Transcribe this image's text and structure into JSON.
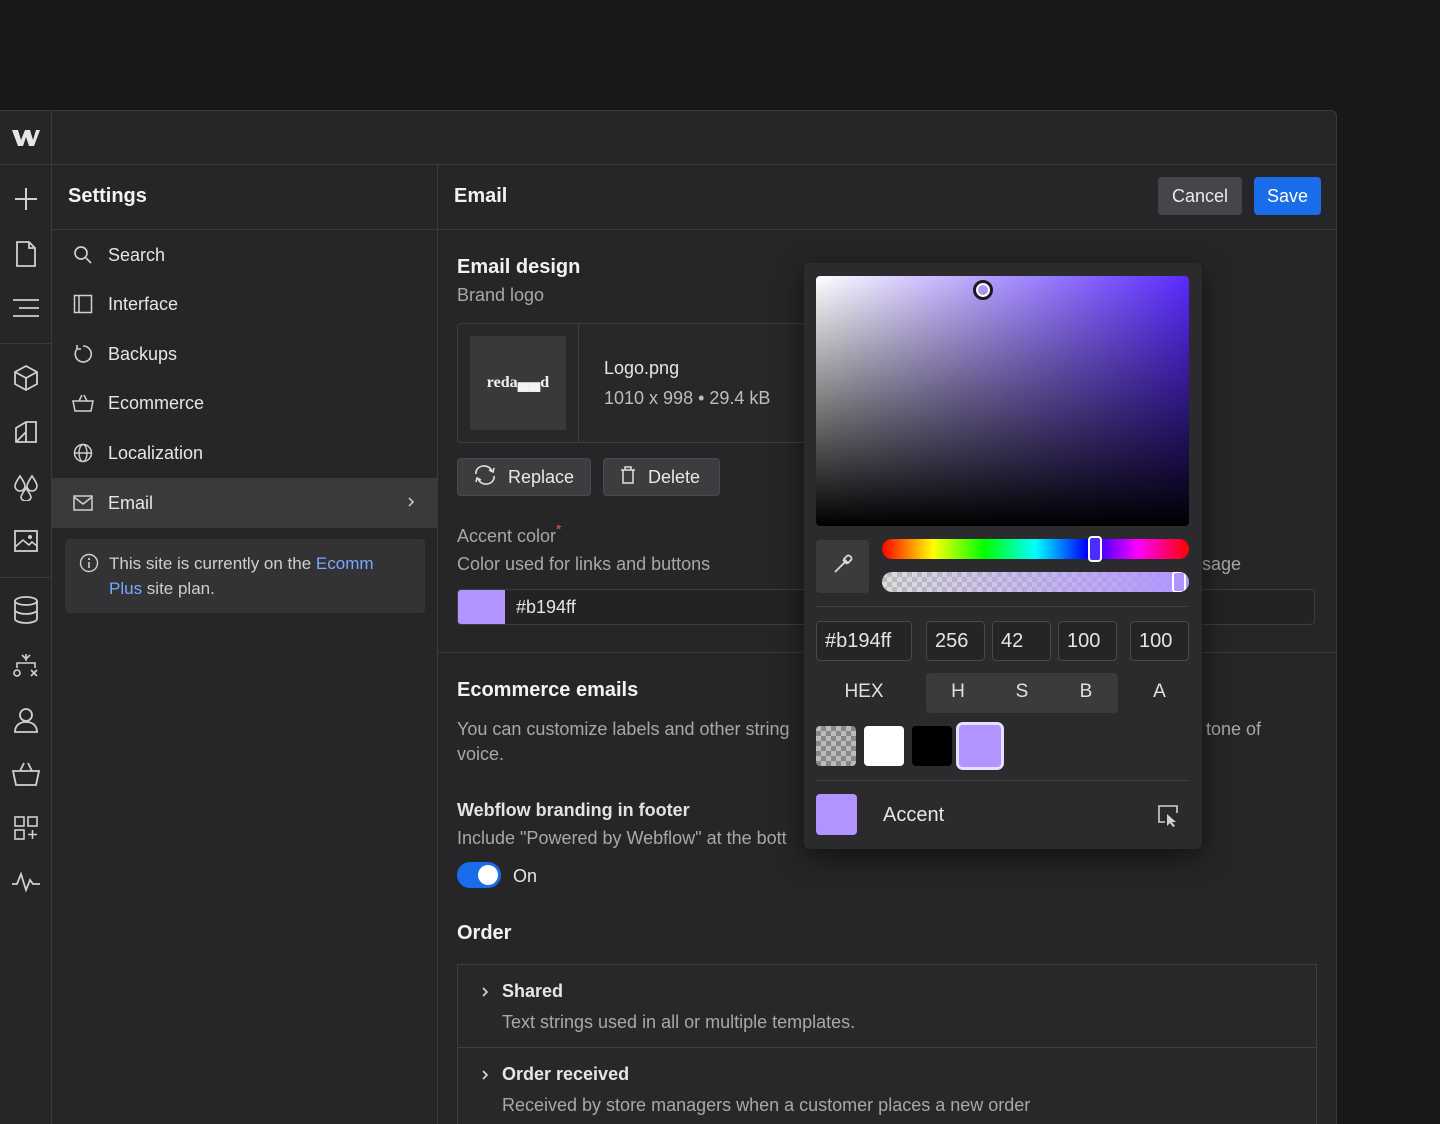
{
  "colors": {
    "accent": "#b194ff",
    "primary_button": "#1a6ce8",
    "link": "#7aa7ff"
  },
  "rail": {
    "icons": [
      "webflow-logo",
      "add-icon",
      "page-icon",
      "navigator-icon",
      "components-icon",
      "style-icon",
      "variables-icon",
      "assets-icon",
      "cms-icon",
      "logic-icon",
      "users-icon",
      "ecommerce-icon",
      "apps-icon",
      "audit-icon"
    ]
  },
  "settings": {
    "title": "Settings",
    "items": [
      {
        "label": "Search",
        "icon": "search-icon"
      },
      {
        "label": "Interface",
        "icon": "panel-icon"
      },
      {
        "label": "Backups",
        "icon": "backup-icon"
      },
      {
        "label": "Ecommerce",
        "icon": "basket-icon"
      },
      {
        "label": "Localization",
        "icon": "globe-icon"
      },
      {
        "label": "Email",
        "icon": "mail-icon"
      }
    ],
    "plan_note": {
      "prefix": "This site is currently on the ",
      "link": "Ecomm Plus",
      "suffix": " site plan."
    }
  },
  "main": {
    "title": "Email",
    "cancel": "Cancel",
    "save": "Save",
    "email_design": {
      "heading": "Email design",
      "brand_logo_label": "Brand logo",
      "logo_thumb_text": "reda▄▄d",
      "file_name": "Logo.png",
      "file_meta": "1010 x 998 • 29.4 kB",
      "replace": "Replace",
      "delete": "Delete",
      "accent_label": "Accent color",
      "accent_required": "*",
      "accent_desc": "Color used for links and buttons",
      "accent_value": "#b194ff",
      "partial_right_text": "sage"
    },
    "ecommerce_emails": {
      "heading": "Ecommerce emails",
      "desc_line1": "You can customize labels and other string",
      "desc_line1_right": "tone of",
      "desc_line2": "voice.",
      "branding_label": "Webflow branding in footer",
      "branding_desc": "Include \"Powered by Webflow\" at the bott",
      "toggle_label": "On"
    },
    "order": {
      "heading": "Order",
      "items": [
        {
          "title": "Shared",
          "desc": "Text strings used in all or multiple templates."
        },
        {
          "title": "Order received",
          "desc": "Received by store managers when a customer places a new order"
        }
      ]
    }
  },
  "picker": {
    "hex": "#b194ff",
    "h": "256",
    "s": "42",
    "b": "100",
    "a": "100",
    "modes": [
      "HEX",
      "H",
      "S",
      "B",
      "A"
    ],
    "swatches": [
      "transparent",
      "#ffffff",
      "#000000",
      "#b194ff"
    ],
    "variable_name": "Accent"
  }
}
